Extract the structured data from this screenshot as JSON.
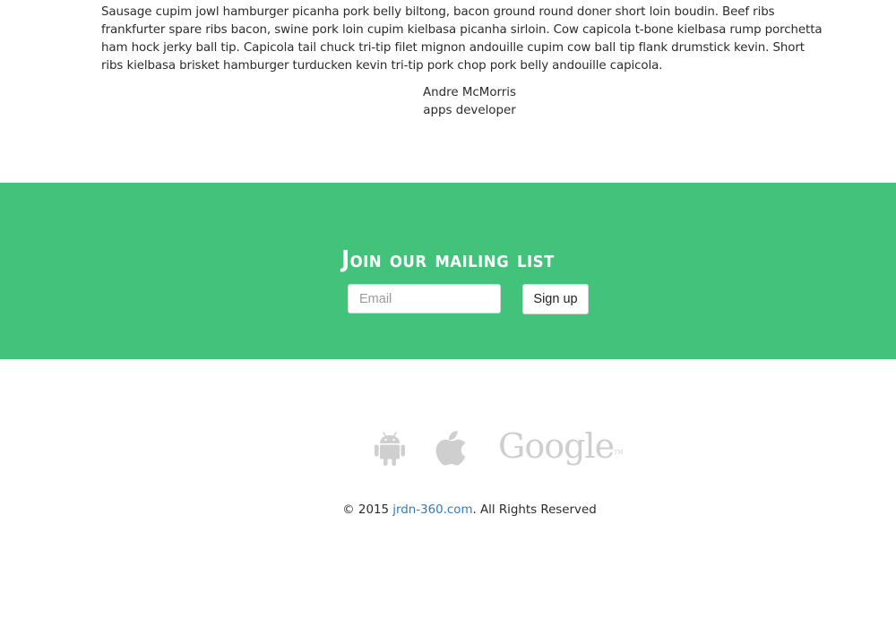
{
  "testimonial": {
    "text": "Sausage cupim jowl hamburger picanha pork belly biltong, bacon ground round doner short loin boudin. Beef ribs frankfurter spare ribs bacon, swine pork loin cupim kielbasa picanha sirloin. Cow capicola t-bone kielbasa rump porchetta ham hock jerky ball tip. Capicola tail chuck tri-tip filet mignon andouille cupim cow ball tip flank drumstick kevin. Short ribs kielbasa brisket hamburger turducken kevin tri-tip pork chop pork belly andouille capicola.",
    "author_name": "Andre McMorris",
    "author_role": "apps developer"
  },
  "mailing": {
    "heading": "Join our mailing list",
    "email_placeholder": "Email",
    "email_value": "",
    "signup_label": "Sign up",
    "background_color": "#43c27c"
  },
  "platforms": {
    "icons": [
      "android-icon",
      "apple-icon",
      "google-logo"
    ],
    "google_text": "Google",
    "google_tm": "TM",
    "icon_color": "#cfcfcf"
  },
  "footer": {
    "copyright_prefix": "© 2015 ",
    "link_text": "jrdn-360.com",
    "copyright_suffix": ". All Rights Reserved",
    "link_color": "#2f7bbf"
  }
}
